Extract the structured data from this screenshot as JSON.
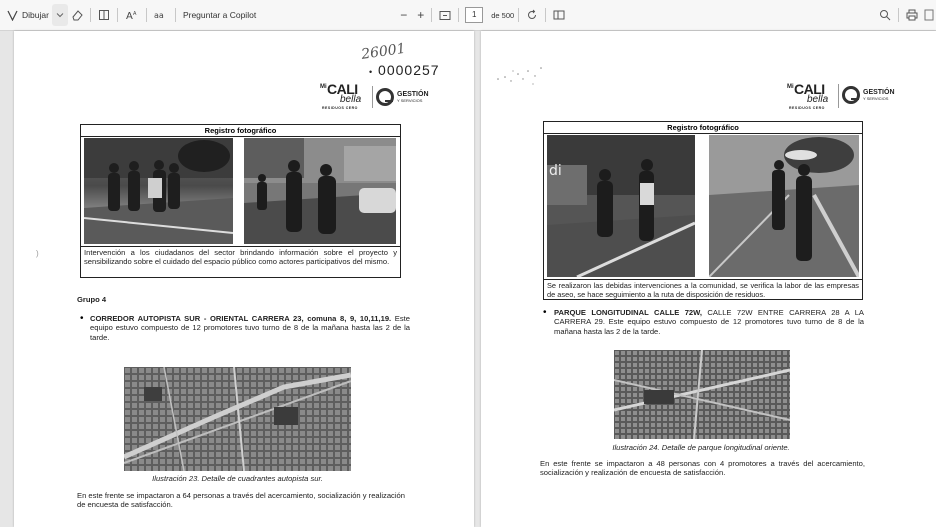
{
  "toolbar": {
    "draw_label": "Dibujar",
    "copilot_label": "Preguntar a Copilot",
    "zoom_out": "−",
    "zoom_in": "+",
    "page_current": "1",
    "page_total": "de 500"
  },
  "page1": {
    "handwritten_number": "26001",
    "stamp_number": "0000257",
    "logo_cali": {
      "mi": "Mi",
      "cali": "CALI",
      "bella": "bella",
      "tagline": "RESIDUOS CERO"
    },
    "logo_gs": {
      "line1": "GESTIÓN",
      "line2": "Y SERVICIOS"
    },
    "photo_title": "Registro fotográfico",
    "photo_caption": "Intervención a los ciudadanos del sector brindando información sobre el proyecto y sensibilizando sobre el cuidado del espacio público como actores participativos del mismo.",
    "group_heading": "Grupo 4",
    "bullet_bold": "CORREDOR AUTOPISTA SUR - ORIENTAL CARRERA 23, comuna 8, 9, 10,11,19.",
    "bullet_text": " Este equipo estuvo compuesto de 12 promotores tuvo turno de 8 de la mañana hasta las 2 de la tarde.",
    "map_caption": "Ilustración 23. Detalle de cuadrantes autopista sur.",
    "closing_text": "En este frente se impactaron a 64 personas a través del acercamiento, socialización y realización de encuesta de satisfacción."
  },
  "page2": {
    "logo_cali": {
      "mi": "Mi",
      "cali": "CALI",
      "bella": "bella",
      "tagline": "RESIDUOS CERO"
    },
    "logo_gs": {
      "line1": "GESTIÓN",
      "line2": "Y SERVICIOS"
    },
    "photo_title": "Registro fotográfico",
    "photo_caption": "Se realizaron las debidas intervenciones a la comunidad, se verifica la labor de las empresas de aseo, se hace seguimiento a la ruta de disposición de residuos.",
    "bullet_bold": "PARQUE LONGITUDINAL CALLE 72W,",
    "bullet_text": " CALLE 72W ENTRE CARRERA 28 A LA CARRERA 29. Este equipo estuvo compuesto de 12 promotores tuvo turno de 8 de la mañana hasta las 2 de la tarde.",
    "map_caption": "Ilustración 24. Detalle de parque longitudinal oriente.",
    "closing_text": "En este frente se impactaron a 48 personas con 4 promotores a través del acercamiento, socialización y realización de encuesta de satisfacción."
  }
}
